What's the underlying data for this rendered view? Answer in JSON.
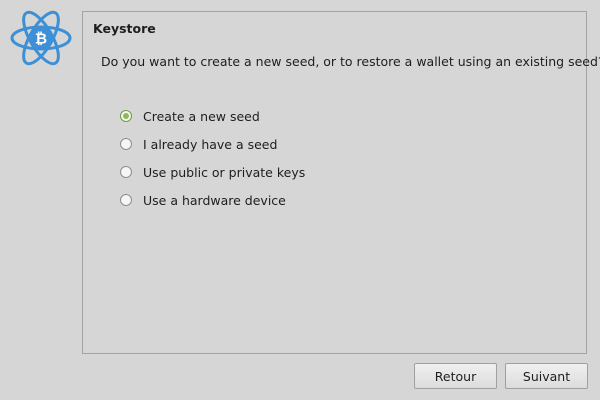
{
  "logo": {
    "icon": "electrum-bitcoin-atom-icon",
    "color": "#3d8fd6"
  },
  "panel": {
    "title": "Keystore",
    "question": "Do you want to create a new seed, or to restore a wallet using an existing seed?"
  },
  "options": [
    {
      "label": "Create a new seed",
      "checked": true
    },
    {
      "label": "I already have a seed",
      "checked": false
    },
    {
      "label": "Use public or private keys",
      "checked": false
    },
    {
      "label": "Use a hardware device",
      "checked": false
    }
  ],
  "buttons": {
    "back_label": "Retour",
    "next_label": "Suivant"
  },
  "colors": {
    "background": "#d6d6d6",
    "accent_radio": "#8db85a",
    "logo_blue": "#3d8fd6"
  }
}
